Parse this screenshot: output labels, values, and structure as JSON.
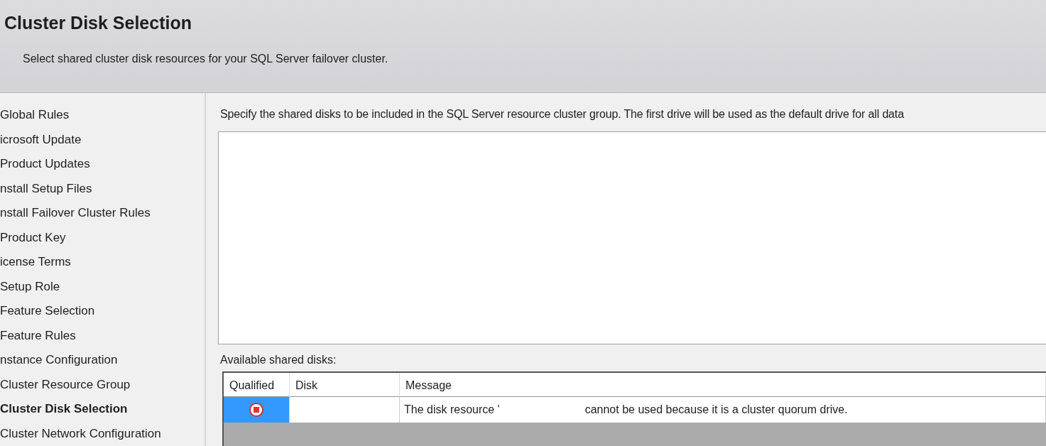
{
  "header": {
    "title": "Cluster Disk Selection",
    "subtitle": "Select shared cluster disk resources for your SQL Server failover cluster."
  },
  "nav": [
    {
      "label": "Global Rules",
      "selected": false
    },
    {
      "label": "icrosoft Update",
      "selected": false
    },
    {
      "label": "Product Updates",
      "selected": false
    },
    {
      "label": "nstall Setup Files",
      "selected": false
    },
    {
      "label": "nstall Failover Cluster Rules",
      "selected": false
    },
    {
      "label": "Product Key",
      "selected": false
    },
    {
      "label": "icense Terms",
      "selected": false
    },
    {
      "label": "Setup Role",
      "selected": false
    },
    {
      "label": "Feature Selection",
      "selected": false
    },
    {
      "label": "Feature Rules",
      "selected": false
    },
    {
      "label": "nstance Configuration",
      "selected": false
    },
    {
      "label": "Cluster Resource Group",
      "selected": false
    },
    {
      "label": "Cluster Disk Selection",
      "selected": true
    },
    {
      "label": "Cluster Network Configuration",
      "selected": false
    }
  ],
  "instruction": "Specify the shared disks to be included in the SQL Server resource cluster group. The first drive will be used as the default drive for all data",
  "disks_label": "Available shared disks:",
  "table": {
    "columns": [
      "Qualified",
      "Disk",
      "Message"
    ],
    "rows": [
      {
        "kind": "error",
        "selected": true,
        "message_start": "The disk resource '",
        "message_end": "cannot be used because it is a cluster quorum drive."
      }
    ]
  }
}
